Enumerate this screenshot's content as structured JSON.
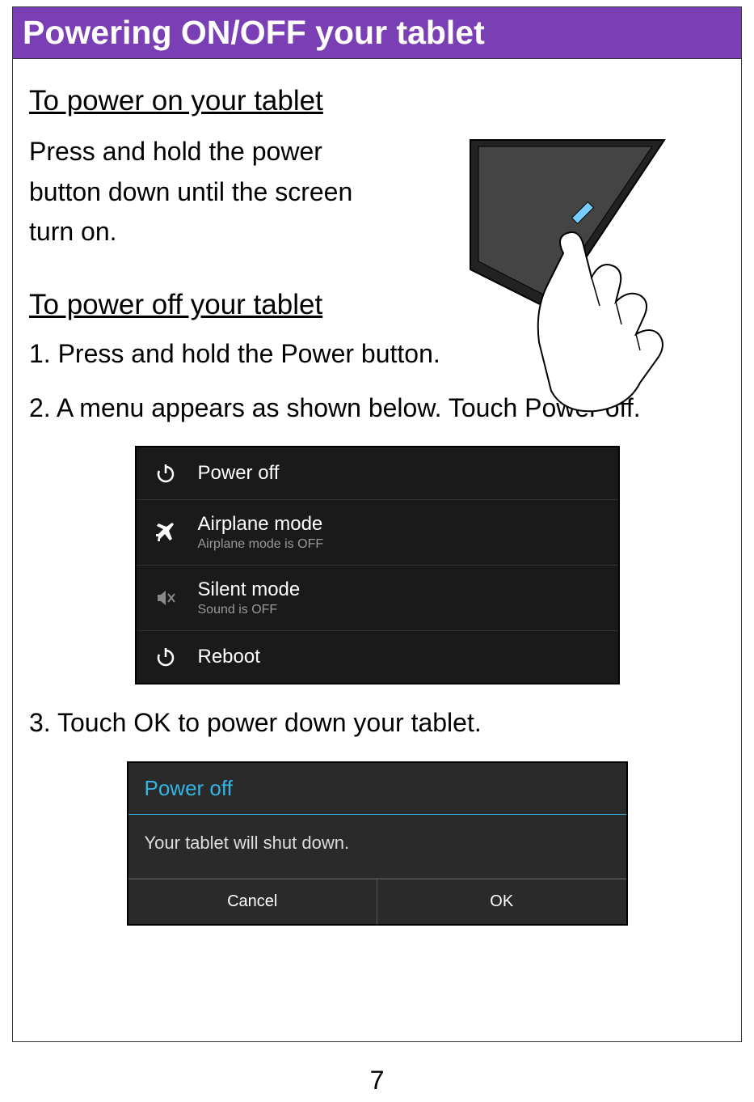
{
  "header": {
    "title": "Powering ON/OFF your tablet"
  },
  "section_on": {
    "title": "To power on your tablet",
    "body": "Press and hold the power button down until the screen turn on."
  },
  "section_off": {
    "title": "To power off your tablet",
    "step1": "1. Press and hold the Power button.",
    "step2": "2. A menu appears as shown below. Touch Power off.",
    "step3": "3. Touch OK to power down your tablet."
  },
  "power_menu": {
    "items": [
      {
        "label": "Power off",
        "sublabel": ""
      },
      {
        "label": "Airplane mode",
        "sublabel": "Airplane mode is OFF"
      },
      {
        "label": "Silent mode",
        "sublabel": "Sound is OFF"
      },
      {
        "label": "Reboot",
        "sublabel": ""
      }
    ]
  },
  "dialog": {
    "title": "Power off",
    "message": "Your tablet will shut down.",
    "cancel": "Cancel",
    "ok": "OK"
  },
  "page_number": "7"
}
